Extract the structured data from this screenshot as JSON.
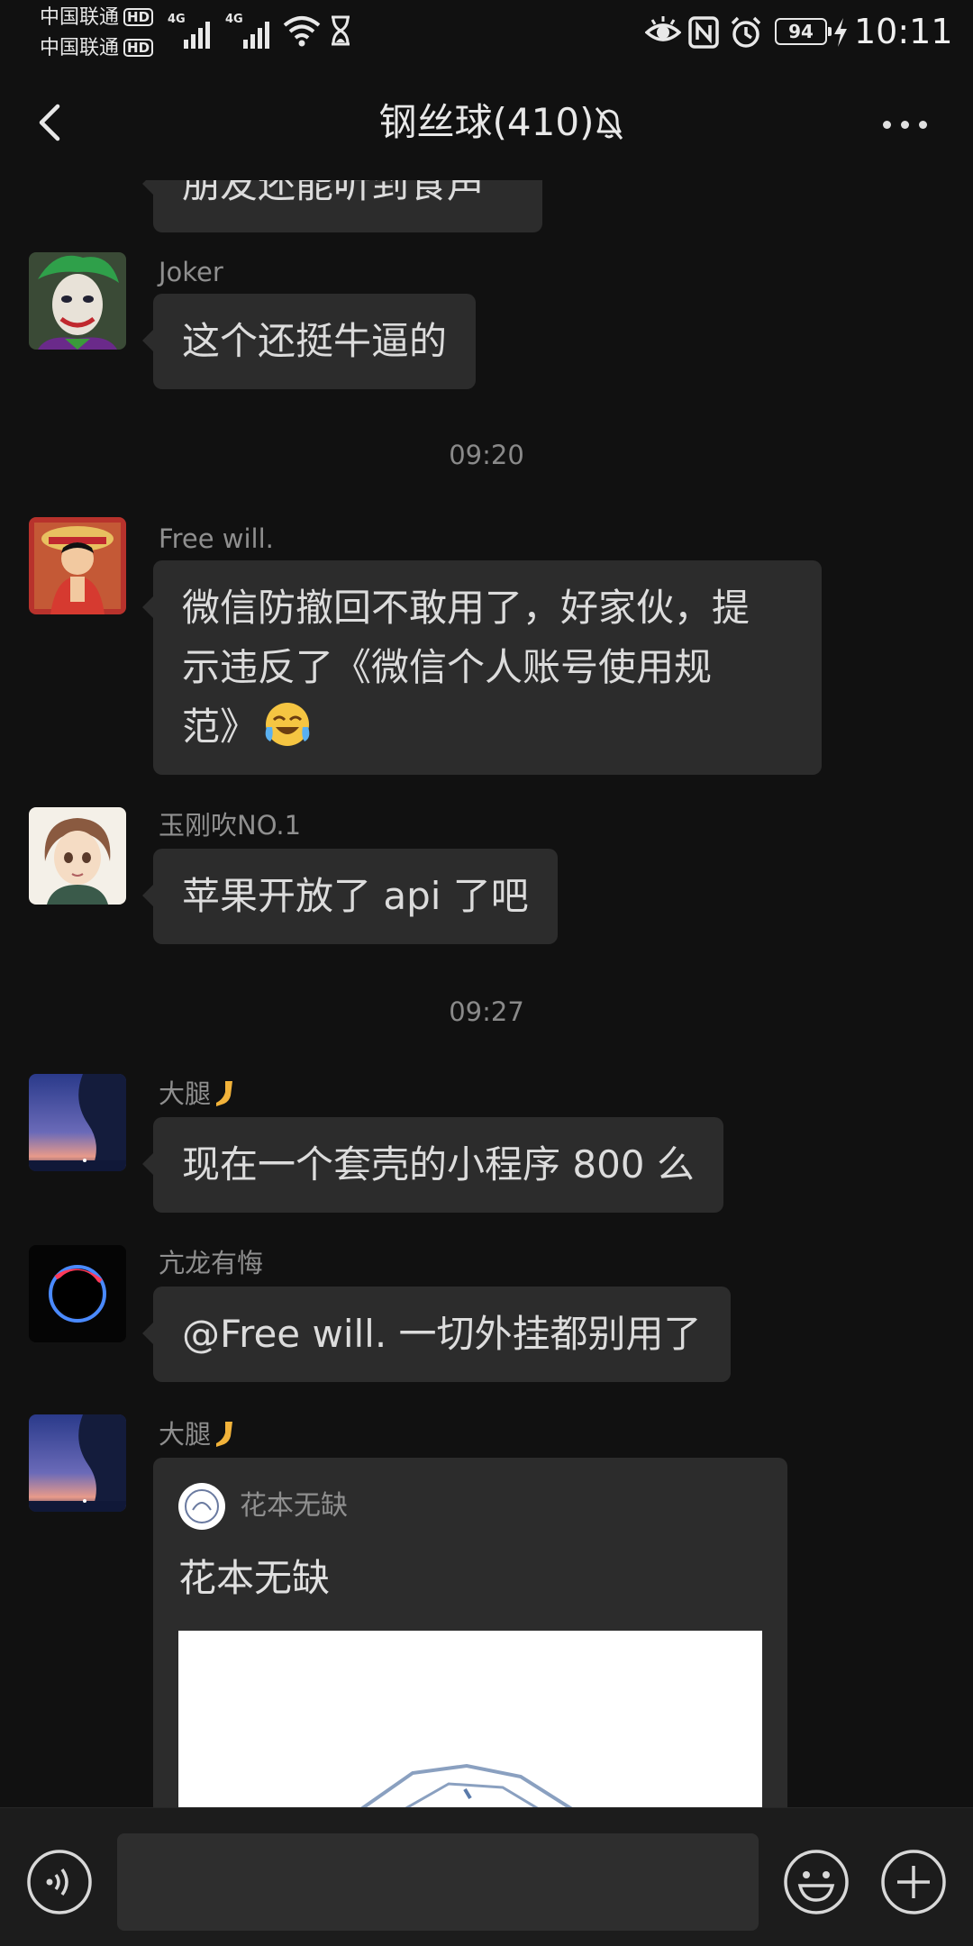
{
  "status_bar": {
    "carrier_1": "中国联通",
    "carrier_2": "中国联通",
    "hd_badge": "HD",
    "network_1": "4G",
    "network_2": "4G",
    "battery": "94",
    "time": "10:11",
    "icons": [
      "signal-icon",
      "wifi-icon",
      "hourglass-icon",
      "eye-icon",
      "nfc-icon",
      "alarm-icon",
      "battery-icon",
      "charging-icon"
    ]
  },
  "nav": {
    "title": "钢丝球(410)",
    "icons": [
      "back-icon",
      "mute-bell-icon",
      "more-icon"
    ]
  },
  "messages": [
    {
      "type": "bubble",
      "sender": "",
      "text": "朋友还能听到食声"
    },
    {
      "type": "bubble",
      "sender": "Joker",
      "text": "这个还挺牛逼的",
      "avatar": "joker-avatar"
    },
    {
      "type": "time",
      "text": "09:20"
    },
    {
      "type": "bubble",
      "sender": "Free will.",
      "text_lines": [
        "微信防撤回不敢用了，好家伙，提",
        "示违反了《微信个人账号使用规",
        "范》"
      ],
      "emoji": "crying-laughing-emoji",
      "avatar": "luffy-avatar"
    },
    {
      "type": "bubble",
      "sender": "玉刚吹NO.1",
      "text": "苹果开放了 api 了吧",
      "avatar": "anime-boy-avatar"
    },
    {
      "type": "time",
      "text": "09:27"
    },
    {
      "type": "bubble",
      "sender": "大腿",
      "sender_emoji": "leg-emoji",
      "text": "现在一个套壳的小程序 800 么",
      "avatar": "sunset-avatar"
    },
    {
      "type": "bubble",
      "sender": "亢龙有悔",
      "text": "@Free will.  一切外挂都别用了",
      "avatar": "eclipse-avatar"
    },
    {
      "type": "card",
      "sender": "大腿",
      "sender_emoji": "leg-emoji",
      "card_source": "花本无缺",
      "card_title": "花本无缺",
      "avatar": "sunset-avatar"
    }
  ],
  "input_bar": {
    "placeholder": "",
    "icons": [
      "voice-icon",
      "emoji-face-icon",
      "plus-icon"
    ]
  },
  "colors": {
    "background": "#111111",
    "bubble": "#2c2c2c",
    "text": "#dcdcdc",
    "secondary": "#8f8f8f"
  }
}
